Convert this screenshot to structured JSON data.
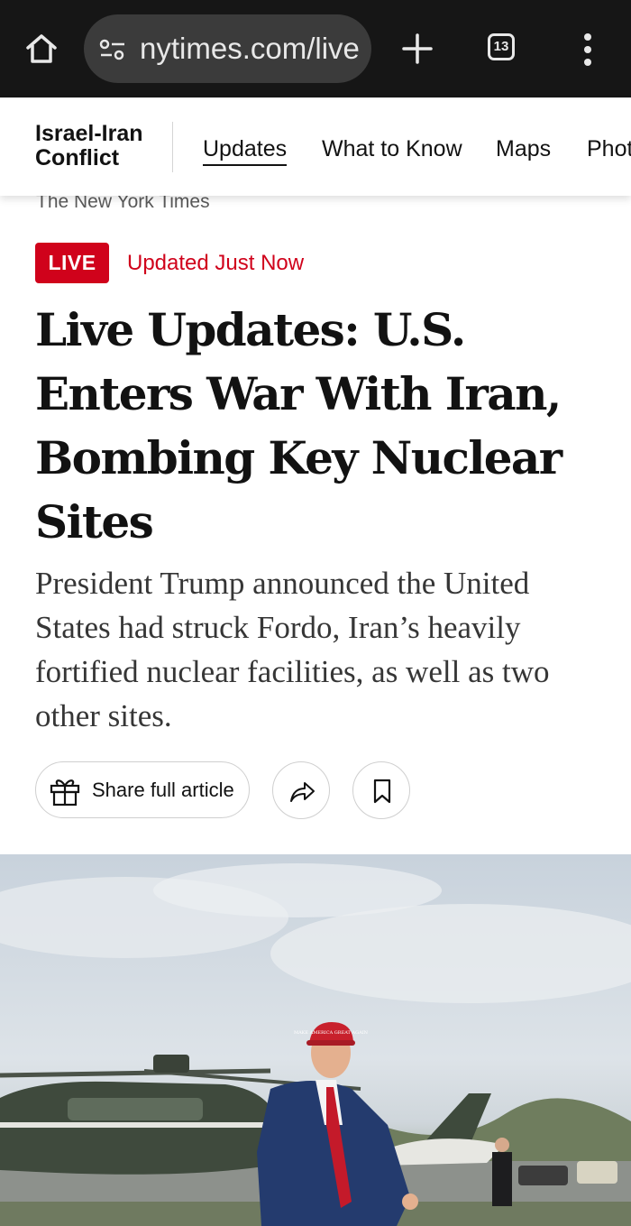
{
  "browser": {
    "url": "nytimes.com/live",
    "tab_count": "13"
  },
  "section_nav": {
    "title": "Israel-Iran Conflict",
    "items": [
      {
        "label": "Updates",
        "active": true
      },
      {
        "label": "What to Know"
      },
      {
        "label": "Maps"
      },
      {
        "label": "Photos"
      }
    ]
  },
  "masthead": "The New York Times",
  "article": {
    "badge": "LIVE",
    "updated": "Updated Just Now",
    "headline": "Live Updates: U.S. Enters War With Iran, Bombing Key Nuclear Sites",
    "summary": "President Trump announced the United States had struck Fordo, Iran’s heavily fortified nuclear facilities, as well as two other sites.",
    "share_label": "Share full article",
    "cap_text": "MAKE AMERICA GREAT AGAIN"
  },
  "colors": {
    "accent_red": "#d0021b",
    "chrome_bg": "#161616",
    "text": "#121212"
  },
  "icons": [
    "home-icon",
    "tune-icon",
    "plus-icon",
    "tabs-icon",
    "more-vert-icon",
    "gift-icon",
    "share-arrow-icon",
    "bookmark-icon"
  ]
}
